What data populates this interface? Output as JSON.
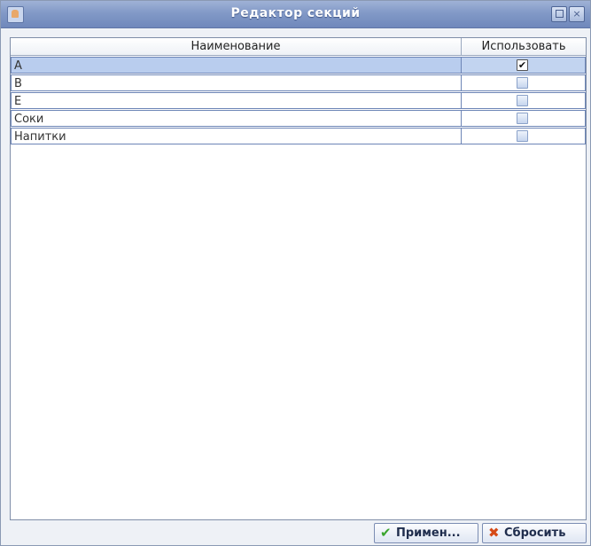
{
  "window": {
    "title": "Редактор секций",
    "app_icon": "java-cup-icon",
    "controls": [
      "restore-icon",
      "close-icon"
    ],
    "close_glyph": "×"
  },
  "table": {
    "columns": [
      "Наименование",
      "Использовать"
    ],
    "rows": [
      {
        "name": "A",
        "use": true,
        "selected": true
      },
      {
        "name": "B",
        "use": false
      },
      {
        "name": "E",
        "use": false
      },
      {
        "name": "Соки",
        "use": false
      },
      {
        "name": "Напитки",
        "use": false
      }
    ],
    "check_glyph": "✔"
  },
  "buttons": {
    "apply_label": "Примен...",
    "apply_icon": "✔",
    "reset_label": "Сбросить",
    "reset_icon": "✖"
  },
  "colors": {
    "titlebar": "#8299c7",
    "selection": "#b9cdee",
    "apply_icon": "#3aa52e",
    "reset_icon": "#d64a16"
  }
}
